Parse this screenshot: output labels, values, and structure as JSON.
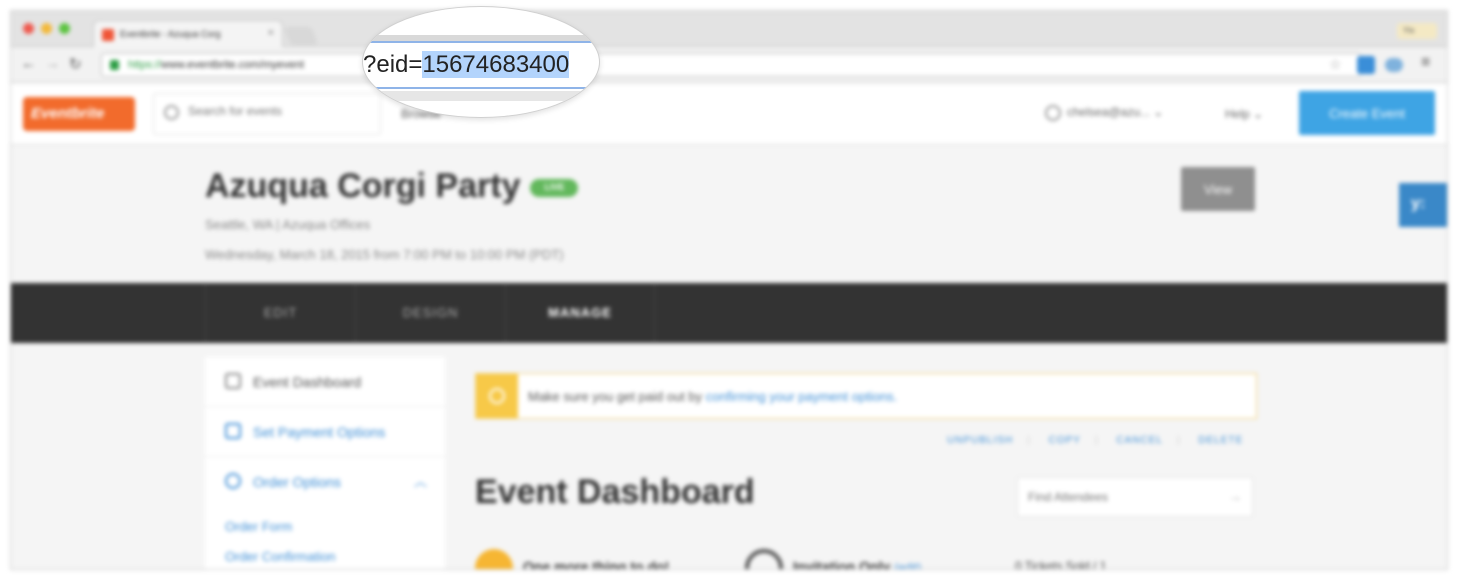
{
  "browser": {
    "tab_title": "Eventbrite - Azuqua Corg",
    "profile": "Ytx",
    "url_https": "https://",
    "url_rest": "www.eventbrite.com/myevent",
    "zoom_prefix": "?eid=",
    "event_id": "15674683400"
  },
  "header": {
    "logo": "Eventbrite",
    "search_placeholder": "Search for events",
    "browse": "Browse",
    "user": "chelsea@azu...",
    "help": "Help",
    "create_event": "Create Event"
  },
  "event": {
    "title": "Azuqua Corgi Party",
    "status": "LIVE",
    "location": "Seattle, WA | Azuqua Offices",
    "date": "Wednesday, March 18, 2015 from 7:00 PM to 10:00 PM (PDT)",
    "view_button": "View",
    "side_tab": "y:"
  },
  "nav": {
    "edit": "EDIT",
    "design": "DESIGN",
    "manage": "MANAGE"
  },
  "sidebar": {
    "items": [
      {
        "label": "Event Dashboard"
      },
      {
        "label": "Set Payment Options"
      },
      {
        "label": "Order Options"
      }
    ],
    "sub_items": [
      "Order Form",
      "Order Confirmation"
    ]
  },
  "main": {
    "alert_text": "Make sure you get paid out by ",
    "alert_link": "confirming your payment options.",
    "actions": [
      "UNPUBLISH",
      "COPY",
      "CANCEL",
      "DELETE"
    ],
    "title": "Event Dashboard",
    "find_placeholder": "Find Attendees",
    "task1": "One more thing to do!",
    "task2": "Invitation Only",
    "task2_edit": "(edit)",
    "tickets": "0 Tickets Sold / 1"
  },
  "colors": {
    "brand": "#f26b2c",
    "primary": "#3ea4e4",
    "link": "#3f8fd6",
    "live": "#62b85c",
    "nav_bg": "#333333",
    "highlight": "#b3d4fc"
  }
}
